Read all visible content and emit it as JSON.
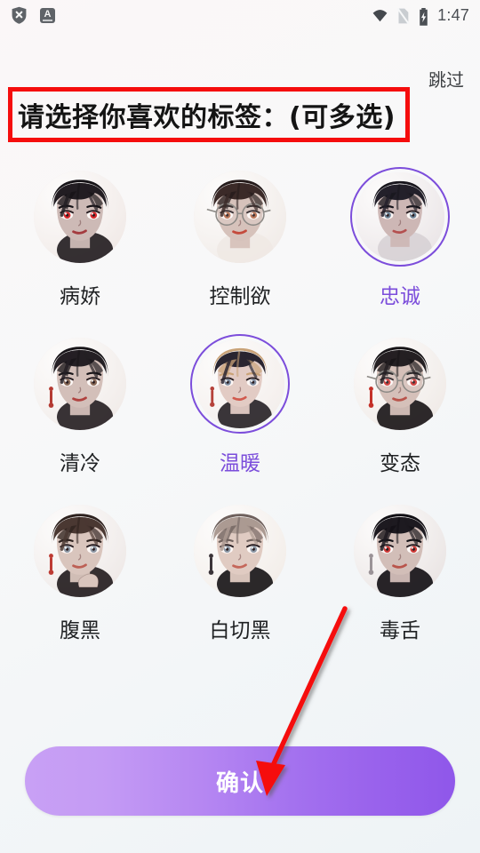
{
  "statusbar": {
    "left_icons": [
      {
        "name": "shield-x-icon",
        "label": "shield-x"
      },
      {
        "name": "keyboard-language-icon",
        "label": "A"
      }
    ],
    "right_icons": [
      {
        "name": "wifi-icon",
        "label": "wifi"
      },
      {
        "name": "signal-off-icon",
        "label": "no-sim"
      },
      {
        "name": "battery-charging-icon",
        "label": "battery-charging"
      }
    ],
    "clock": "1:47"
  },
  "header": {
    "skip_label": "跳过",
    "title": "请选择你喜欢的标签：(可多选)"
  },
  "colors": {
    "accent_purple": "#7b4ddb",
    "ring_purple": "#7c4ddb",
    "annotation_red": "#f50d0d",
    "button_gradient_start": "#c8a0f5",
    "button_gradient_end": "#8f57ea",
    "title_text": "#141414",
    "background": "#f7f8f9"
  },
  "tags": [
    {
      "label": "病娇",
      "selected": false,
      "avatar": "yandere-dark-hair-red-eyes"
    },
    {
      "label": "控制欲",
      "selected": false,
      "avatar": "man-with-glasses-stern"
    },
    {
      "label": "忠诚",
      "selected": true,
      "avatar": "loyal-young-man-side-profile"
    },
    {
      "label": "清冷",
      "selected": false,
      "avatar": "cold-woman-long-dark-hair-earring"
    },
    {
      "label": "温暖",
      "selected": true,
      "avatar": "warm-smiling-woman"
    },
    {
      "label": "变态",
      "selected": false,
      "avatar": "glasses-man-red-eyes-earring"
    },
    {
      "label": "腹黑",
      "selected": false,
      "avatar": "scheming-man-hand-on-chin"
    },
    {
      "label": "白切黑",
      "selected": false,
      "avatar": "pale-hair-man-cold-stare"
    },
    {
      "label": "毒舌",
      "selected": false,
      "avatar": "sharp-tongue-man-red-eyes"
    }
  ],
  "footer": {
    "confirm_label": "确认"
  },
  "annotations": {
    "title_box": "red rectangle highlighting the title",
    "arrow": "red arrow pointing to confirm button"
  }
}
